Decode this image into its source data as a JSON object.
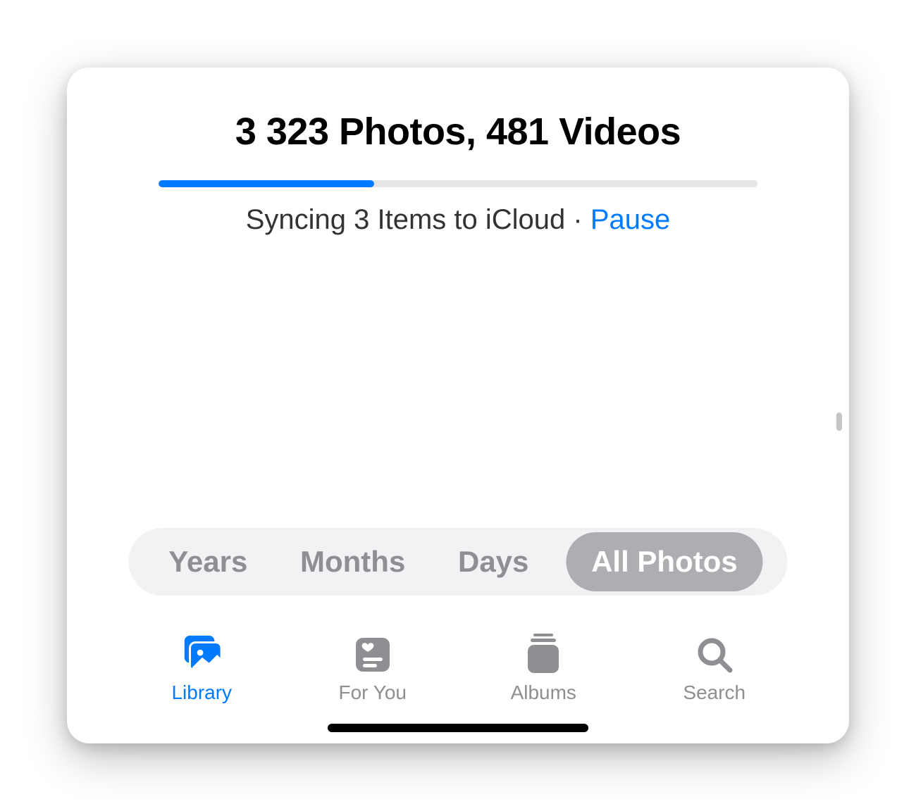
{
  "header": {
    "title": "3 323 Photos, 481 Videos"
  },
  "sync": {
    "status_text": "Syncing 3 Items to iCloud",
    "separator": " · ",
    "pause_label": "Pause",
    "progress_percent": 36
  },
  "segmented": {
    "items": [
      {
        "label": "Years",
        "active": false
      },
      {
        "label": "Months",
        "active": false
      },
      {
        "label": "Days",
        "active": false
      },
      {
        "label": "All Photos",
        "active": true
      }
    ]
  },
  "tabbar": {
    "items": [
      {
        "label": "Library",
        "icon": "library-icon",
        "active": true
      },
      {
        "label": "For You",
        "icon": "for-you-icon",
        "active": false
      },
      {
        "label": "Albums",
        "icon": "albums-icon",
        "active": false
      },
      {
        "label": "Search",
        "icon": "search-icon",
        "active": false
      }
    ]
  },
  "colors": {
    "accent": "#007aff",
    "inactive": "#8e8e93",
    "seg_active_bg": "#aeaeb2"
  }
}
